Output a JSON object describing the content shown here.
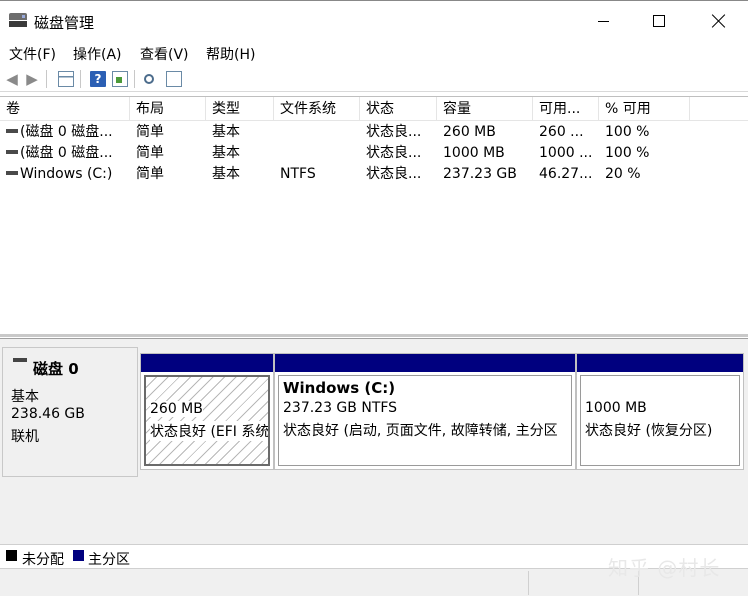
{
  "window": {
    "title": "磁盘管理"
  },
  "menu": [
    "文件(F)",
    "操作(A)",
    "查看(V)",
    "帮助(H)"
  ],
  "table": {
    "columns": [
      "卷",
      "布局",
      "类型",
      "文件系统",
      "状态",
      "容量",
      "可用...",
      "% 可用"
    ],
    "rows": [
      {
        "volume": "(磁盘 0 磁盘...",
        "layout": "简单",
        "type": "基本",
        "fs": "",
        "status": "状态良...",
        "capacity": "260 MB",
        "free": "260 ...",
        "pct": "100 %"
      },
      {
        "volume": "(磁盘 0 磁盘...",
        "layout": "简单",
        "type": "基本",
        "fs": "",
        "status": "状态良...",
        "capacity": "1000 MB",
        "free": "1000 ...",
        "pct": "100 %"
      },
      {
        "volume": "Windows (C:)",
        "layout": "简单",
        "type": "基本",
        "fs": "NTFS",
        "status": "状态良...",
        "capacity": "237.23 GB",
        "free": "46.27...",
        "pct": "20 %"
      }
    ]
  },
  "disk": {
    "name": "磁盘 0",
    "type": "基本",
    "size": "238.46 GB",
    "state": "联机",
    "partitions": [
      {
        "title": "",
        "size": "260 MB",
        "status": "状态良好 (EFI 系统",
        "selected": true
      },
      {
        "title": "Windows  (C:)",
        "size": "237.23 GB NTFS",
        "status": "状态良好 (启动, 页面文件, 故障转储, 主分区",
        "selected": false
      },
      {
        "title": "",
        "size": "1000 MB",
        "status": "状态良好 (恢复分区)",
        "selected": false
      }
    ]
  },
  "legend": {
    "unallocated": "未分配",
    "primary": "主分区",
    "colors": {
      "unallocated": "#000000",
      "primary": "#00007f"
    }
  },
  "watermark": "知乎 @村长"
}
